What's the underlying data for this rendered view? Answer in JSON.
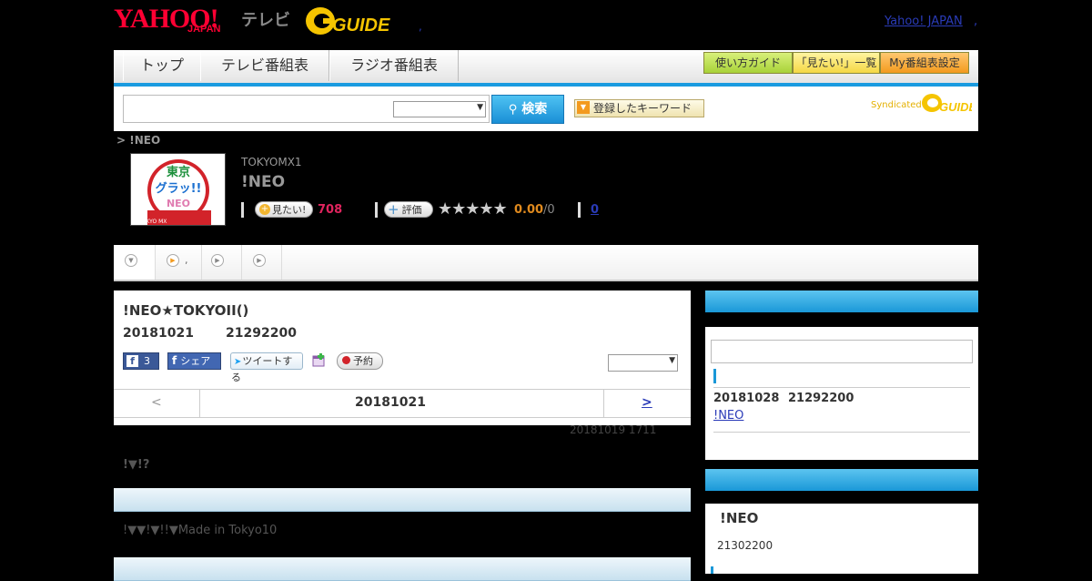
{
  "header": {
    "yahoo_logo": "YAHOO!",
    "yahoo_logo_sub": "JAPAN",
    "tv_label": "テレビ",
    "gguide_logo": "G-GUIDE",
    "yahoo_link": "Yahoo! JAPAN",
    "link_dot": ",",
    "head_dot": ","
  },
  "nav": {
    "tabs": [
      "トップ",
      "テレビ番組表",
      "ラジオ番組表"
    ],
    "buttons": [
      "使い方ガイド",
      "「見たい!」一覧",
      "My番組表設定"
    ]
  },
  "search": {
    "placeholder": "",
    "select_value": "",
    "button_label": "検索",
    "keyword_button": "登録したキーワード",
    "syndicated": "Syndicated"
  },
  "program": {
    "breadcrumb": "> !NEO",
    "thumbnail_text": [
      "東京",
      "グラッ!!",
      "NEO",
      "©TOKYO MX"
    ],
    "channel": "TOKYOMX1",
    "title": "!NEO",
    "watch_button": "見たい!",
    "watch_count": "708",
    "rate_button": "評価",
    "stars": "★★★★★",
    "star_value": 0,
    "rating": "0.00",
    "rating_count": "/0",
    "comment_count": "0"
  },
  "tabstrip": {
    "tab2_label": ","
  },
  "episode": {
    "title": "!NEO★TOKYOII()",
    "date": "20181021",
    "time": "21292200",
    "fb_like": "3",
    "fb_share": "シェア",
    "tweet": "ツイートする",
    "reserve": "予約",
    "select_value": "",
    "prev": "<",
    "nav_date": "20181021",
    "next": ">",
    "updated": "20181019  1711",
    "summary": "!▼!?",
    "detail": "!▼▼!▼!!▼Made in Tokyo10"
  },
  "sidebar": {
    "next_date": "20181028",
    "next_time": "21292200",
    "next_link": "!NEO ",
    "related_title": "!NEO",
    "related_time": "21302200"
  }
}
